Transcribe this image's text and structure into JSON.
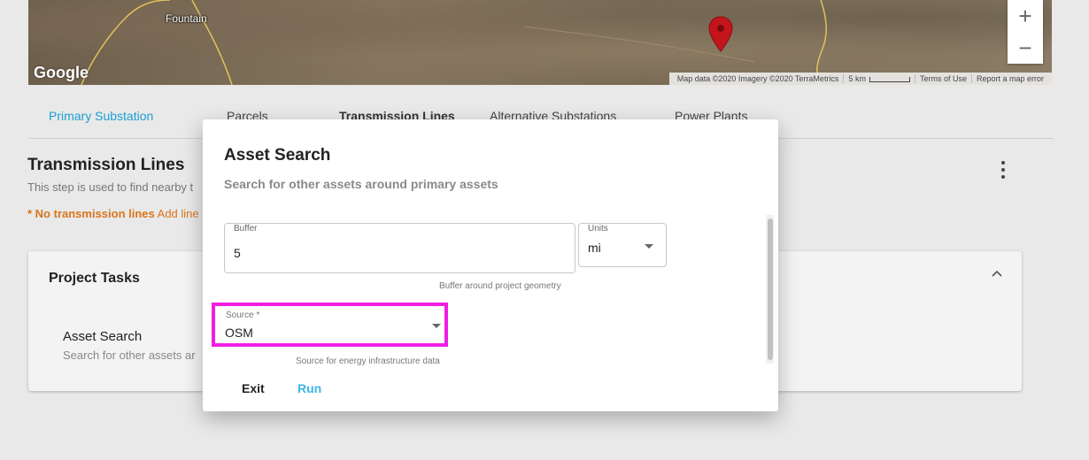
{
  "map": {
    "town_label": "Fountain",
    "logo": "Google",
    "attribution": "Map data ©2020 Imagery ©2020 TerraMetrics",
    "scale_label": "5 km",
    "terms": "Terms of Use",
    "report": "Report a map error",
    "zoom_in": "+",
    "zoom_out": "−",
    "pin_color": "#c4151c"
  },
  "tabs": [
    "Primary Substation",
    "Parcels",
    "Transmission Lines",
    "Alternative Substations",
    "Power Plants"
  ],
  "section": {
    "title": "Transmission Lines",
    "description": "This step is used to find nearby t",
    "warning_bold": "* No transmission lines",
    "warning_rest": " Add line"
  },
  "tasks": {
    "title": "Project Tasks",
    "item_name": "Asset Search",
    "item_desc": "Search for other assets ar"
  },
  "modal": {
    "title": "Asset Search",
    "subtitle": "Search for other assets around primary assets",
    "buffer_label": "Buffer",
    "buffer_value": "5",
    "buffer_helper": "Buffer around project geometry",
    "units_label": "Units",
    "units_value": "mi",
    "source_label": "Source *",
    "source_value": "OSM",
    "source_helper": "Source for energy infrastructure data",
    "exit_label": "Exit",
    "run_label": "Run"
  },
  "colors": {
    "accent": "#1a9fd4",
    "run": "#3ab6e4",
    "warning": "#d9751a",
    "highlight": "#f01ee3"
  }
}
